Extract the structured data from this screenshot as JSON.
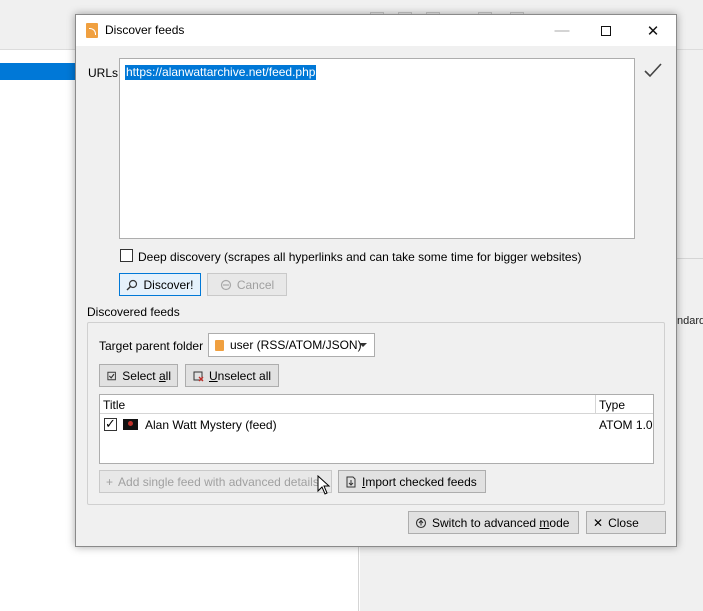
{
  "background": {
    "right_panel_text": "ndard"
  },
  "dialog": {
    "title": "Discover feeds",
    "close_glyph": "✕",
    "min_glyph": "—",
    "urls": {
      "label": "URLs",
      "value": "https://alanwattarchive.net/feed.php"
    },
    "deep_discovery": {
      "label": "Deep discovery (scrapes all hyperlinks and can take some time for bigger websites)",
      "checked": false
    },
    "discover_button": {
      "icon": "search-icon",
      "label": "Discover!"
    },
    "cancel_button": {
      "icon": "cancel-icon",
      "label": "Cancel",
      "enabled": false
    },
    "discovered": {
      "section_label": "Discovered feeds",
      "target_label": "Target parent folder",
      "target_value": "user (RSS/ATOM/JSON)",
      "select_all": {
        "pre": "Select ",
        "key": "a",
        "post": "ll"
      },
      "unselect_all": {
        "key": "U",
        "post": "nselect all"
      },
      "columns": {
        "title": "Title",
        "type": "Type"
      },
      "rows": [
        {
          "checked": true,
          "check_glyph": "✓",
          "title": "Alan Watt Mystery (feed)",
          "type": "ATOM 1.0"
        }
      ],
      "add_single": {
        "icon": "plus-icon",
        "glyph": "+",
        "label": "Add single feed with advanced details",
        "enabled": false
      },
      "import_checked": {
        "icon": "import-icon",
        "key": "I",
        "post": "mport checked feeds"
      }
    },
    "switch_button": {
      "icon": "switch-icon",
      "pre": "Switch to advanced ",
      "key": "m",
      "post": "ode"
    },
    "close_button": {
      "icon": "close-icon",
      "glyph": "✕",
      "label": "Close"
    }
  }
}
